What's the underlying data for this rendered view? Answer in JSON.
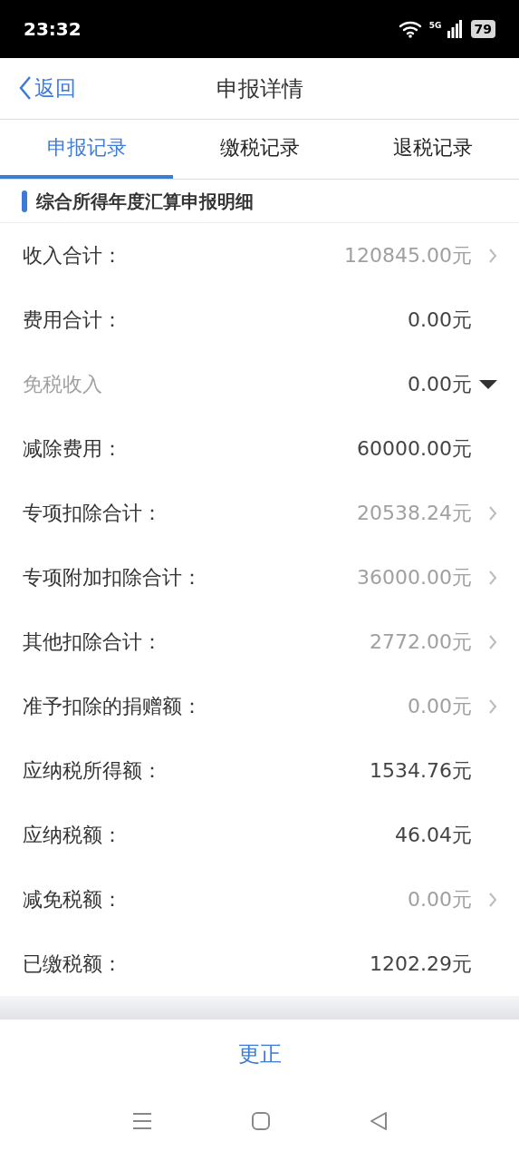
{
  "status_bar": {
    "time": "23:32",
    "network": "5G",
    "battery": "79"
  },
  "nav": {
    "back": "返回",
    "title": "申报详情"
  },
  "tabs": [
    {
      "label": "申报记录",
      "selected": true
    },
    {
      "label": "缴税记录",
      "selected": false
    },
    {
      "label": "退税记录",
      "selected": false
    }
  ],
  "section_title": "综合所得年度汇算申报明细",
  "rows": [
    {
      "label": "收入合计：",
      "value": "120845.00元",
      "kind": "link"
    },
    {
      "label": "费用合计：",
      "value": "0.00元",
      "kind": "plain"
    },
    {
      "label": "免税收入",
      "value": "0.00元",
      "kind": "dropdown",
      "expanded": false
    },
    {
      "label": "减除费用：",
      "value": "60000.00元",
      "kind": "plain"
    },
    {
      "label": "专项扣除合计：",
      "value": "20538.24元",
      "kind": "link"
    },
    {
      "label": "专项附加扣除合计：",
      "value": "36000.00元",
      "kind": "link"
    },
    {
      "label": "其他扣除合计：",
      "value": "2772.00元",
      "kind": "link"
    },
    {
      "label": "准予扣除的捐赠额：",
      "value": "0.00元",
      "kind": "link"
    },
    {
      "label": "应纳税所得额：",
      "value": "1534.76元",
      "kind": "plain"
    },
    {
      "label": "应纳税额：",
      "value": "46.04元",
      "kind": "plain"
    },
    {
      "label": "减免税额：",
      "value": "0.00元",
      "kind": "link"
    },
    {
      "label": "已缴税额：",
      "value": "1202.29元",
      "kind": "plain"
    }
  ],
  "action": "更正"
}
